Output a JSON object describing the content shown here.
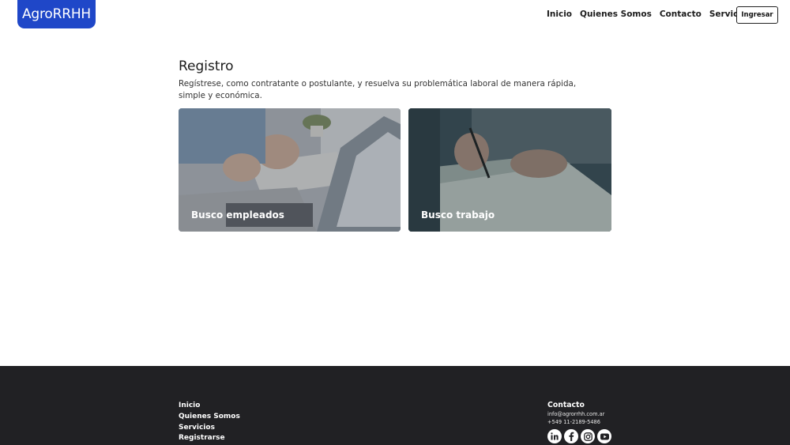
{
  "header": {
    "logo": "AgroRRHH",
    "nav": [
      "Inicio",
      "Quienes Somos",
      "Contacto",
      "Servicios"
    ],
    "login_label": "Ingresar"
  },
  "main": {
    "title": "Registro",
    "intro": "Regístrese, como contratante o postulante, y resuelva su problemática laboral de manera rápida, simple y económica.",
    "cards": [
      {
        "label": "Busco empleados"
      },
      {
        "label": "Busco trabajo"
      }
    ]
  },
  "footer": {
    "links": [
      "Inicio",
      "Quienes Somos",
      "Servicios",
      "Registrarse"
    ],
    "contact": {
      "title": "Contacto",
      "email": "info@agrorrhh.com.ar",
      "phone": "+549 11-2189-5486"
    },
    "social_icons": [
      "linkedin-icon",
      "facebook-icon",
      "instagram-icon",
      "youtube-icon"
    ]
  },
  "colors": {
    "brand": "#1f47c8",
    "footer_bg": "#212124"
  }
}
